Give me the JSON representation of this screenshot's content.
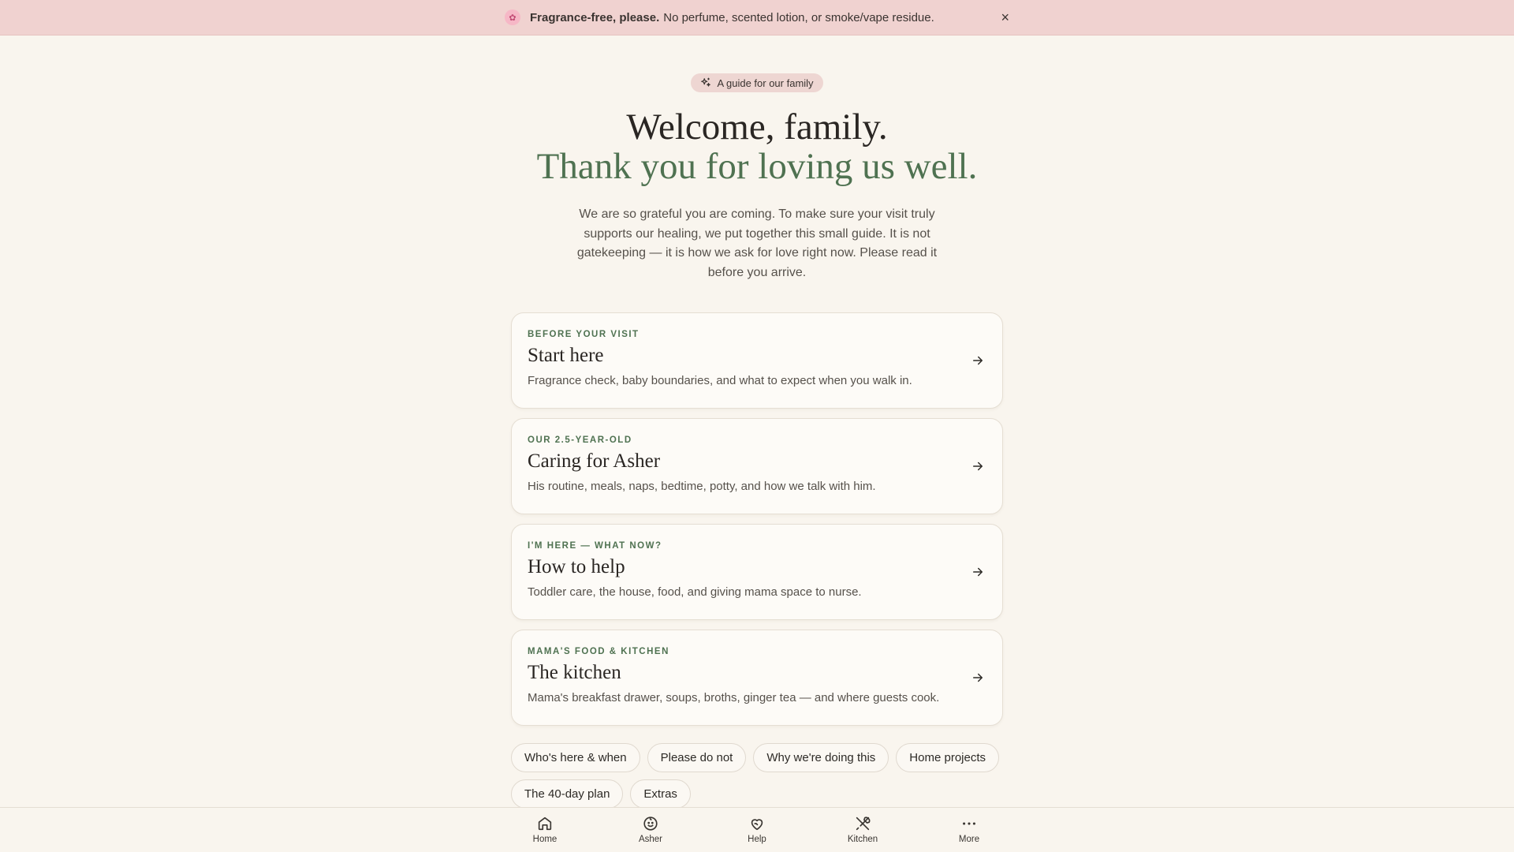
{
  "banner": {
    "icon": "flower-icon",
    "bold": "Fragrance-free, please.",
    "text": "No perfume, scented lotion, or smoke/vape residue.",
    "close": "×"
  },
  "hero": {
    "pill": "A guide for our family",
    "title_line1": "Welcome, family.",
    "title_line2": "Thank you for loving us well.",
    "intro": "We are so grateful you are coming. To make sure your visit truly supports our healing, we put together this small guide. It is not gatekeeping — it is how we ask for love right now. Please read it before you arrive."
  },
  "cards": [
    {
      "kicker": "BEFORE YOUR VISIT",
      "title": "Start here",
      "desc": "Fragrance check, baby boundaries, and what to expect when you walk in."
    },
    {
      "kicker": "OUR 2.5-YEAR-OLD",
      "title": "Caring for Asher",
      "desc": "His routine, meals, naps, bedtime, potty, and how we talk with him."
    },
    {
      "kicker": "I'M HERE — WHAT NOW?",
      "title": "How to help",
      "desc": "Toddler care, the house, food, and giving mama space to nurse."
    },
    {
      "kicker": "MAMA'S FOOD & KITCHEN",
      "title": "The kitchen",
      "desc": "Mama's breakfast drawer, soups, broths, ginger tea — and where guests cook."
    }
  ],
  "chips": [
    "Who's here & when",
    "Please do not",
    "Why we're doing this",
    "Home projects",
    "The 40-day plan",
    "Extras"
  ],
  "nav": [
    {
      "label": "Home",
      "icon": "home-icon"
    },
    {
      "label": "Asher",
      "icon": "child-face-icon"
    },
    {
      "label": "Help",
      "icon": "heart-hand-icon"
    },
    {
      "label": "Kitchen",
      "icon": "utensils-icon"
    },
    {
      "label": "More",
      "icon": "more-dots-icon"
    }
  ],
  "colors": {
    "background": "#f9f5ee",
    "banner": "#f0d2d0",
    "accent_green": "#4f7251",
    "pill": "#eed6d2"
  }
}
